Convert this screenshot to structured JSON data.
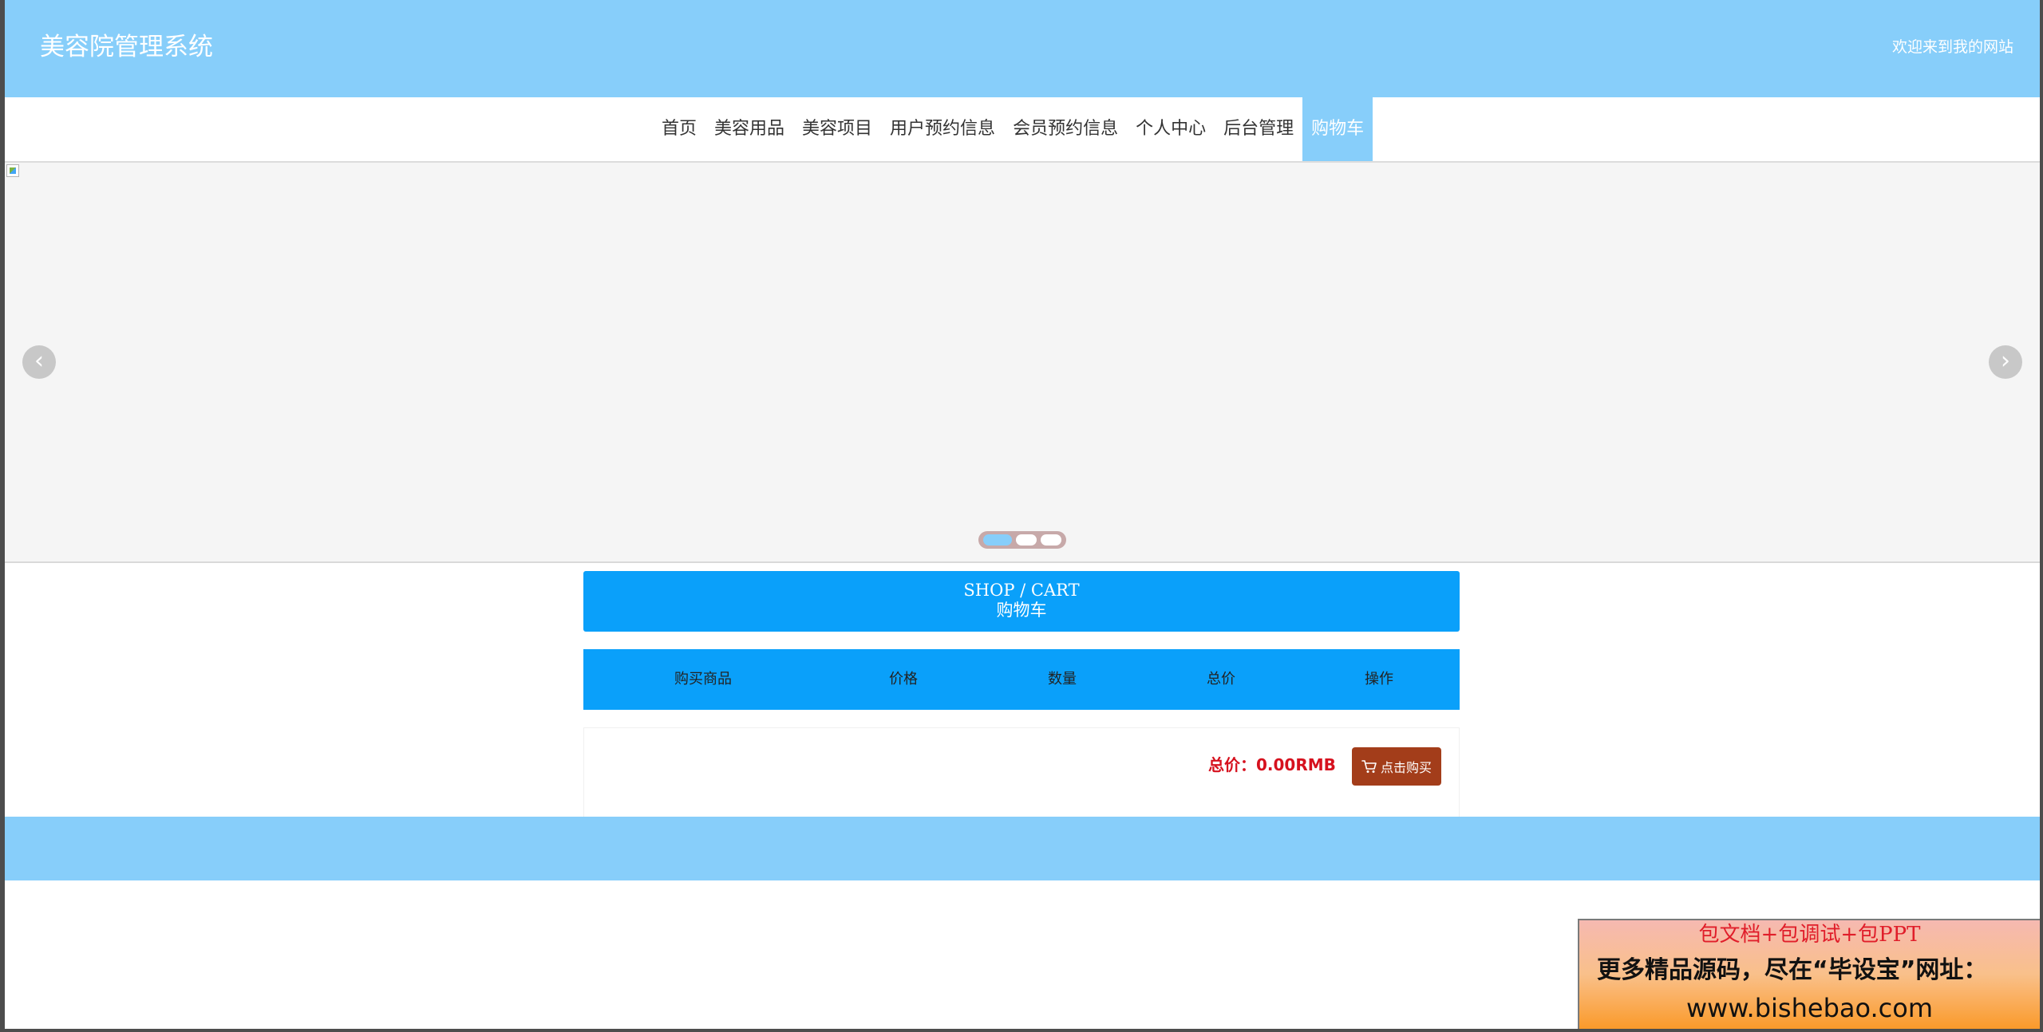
{
  "header": {
    "site_title": "美容院管理系统",
    "welcome": "欢迎来到我的网站"
  },
  "nav": {
    "items": [
      {
        "label": "首页"
      },
      {
        "label": "美容用品"
      },
      {
        "label": "美容项目"
      },
      {
        "label": "用户预约信息"
      },
      {
        "label": "会员预约信息"
      },
      {
        "label": "个人中心"
      },
      {
        "label": "后台管理"
      },
      {
        "label": "购物车"
      }
    ],
    "active": "购物车"
  },
  "carousel": {
    "prev_glyph": "‹",
    "next_glyph": "›",
    "slide_count": 3,
    "active_index": 0
  },
  "cart": {
    "title_en": "SHOP / CART",
    "title_cn": "购物车",
    "columns": [
      "购买商品",
      "价格",
      "数量",
      "总价",
      "操作"
    ],
    "total_text": "总价：0.00RMB",
    "buy_label": "点击购买",
    "buy_icon": "cart-icon"
  },
  "ad": {
    "line1": "包文档+包调试+包PPT",
    "line2": "更多精品源码，尽在“毕设宝”网址：",
    "line3": "www.bishebao.com"
  },
  "colors": {
    "header_bg": "#87cefa",
    "nav_active_bg": "#87cefa",
    "panel_blue": "#0aa0fa",
    "price_red": "#d6111e",
    "buy_button_bg": "#a33d1a"
  }
}
